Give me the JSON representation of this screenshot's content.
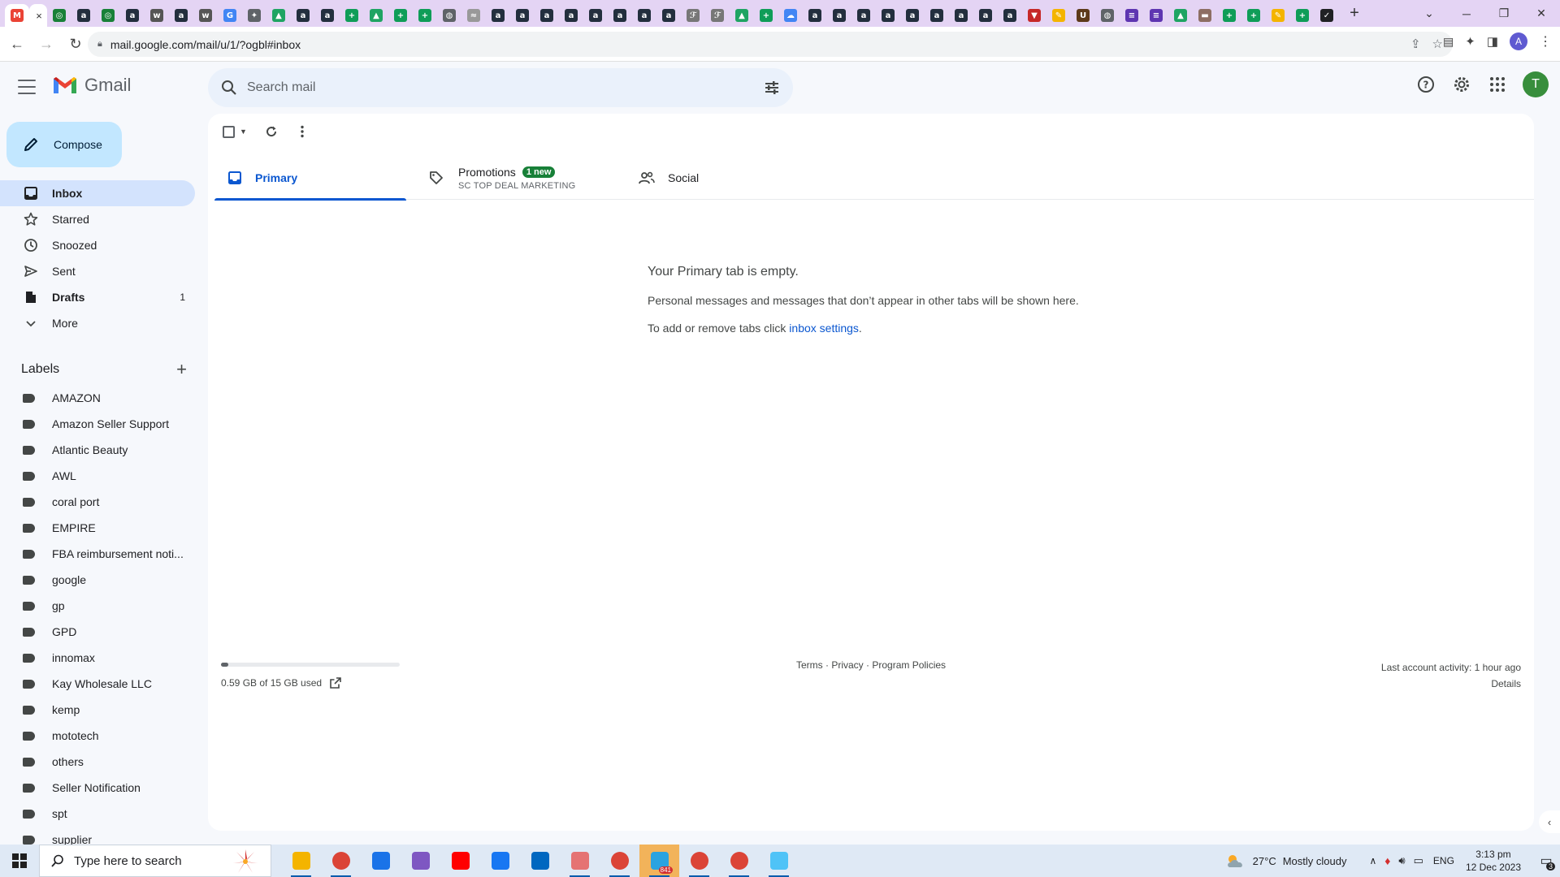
{
  "browser": {
    "url": "mail.google.com/mail/u/1/?ogbl#inbox",
    "profile_initial": "A",
    "tabs": [
      {
        "icon": "gmail-favicon",
        "color": "#ea4335",
        "glyph": "M"
      },
      {
        "icon": "active-tab-close",
        "color": "#ffffff",
        "glyph": "×"
      },
      {
        "icon": "green-circle-favicon",
        "color": "#188038",
        "glyph": "◎"
      },
      {
        "icon": "amazon-favicon",
        "color": "#232f3e",
        "glyph": "a"
      },
      {
        "icon": "green-circle-favicon",
        "color": "#188038",
        "glyph": "◎"
      },
      {
        "icon": "amazon-favicon",
        "color": "#232f3e",
        "glyph": "a"
      },
      {
        "icon": "wix-favicon",
        "color": "#555555",
        "glyph": "w"
      },
      {
        "icon": "amazon-favicon",
        "color": "#232f3e",
        "glyph": "a"
      },
      {
        "icon": "wix-favicon",
        "color": "#555555",
        "glyph": "w"
      },
      {
        "icon": "google-favicon",
        "color": "#4285f4",
        "glyph": "G"
      },
      {
        "icon": "puzzle-favicon",
        "color": "#5f6368",
        "glyph": "✦"
      },
      {
        "icon": "drive-favicon",
        "color": "#1fa463",
        "glyph": "▲"
      },
      {
        "icon": "amazon-favicon",
        "color": "#232f3e",
        "glyph": "a"
      },
      {
        "icon": "amazon-favicon",
        "color": "#232f3e",
        "glyph": "a"
      },
      {
        "icon": "sheets-favicon",
        "color": "#0f9d58",
        "glyph": "+"
      },
      {
        "icon": "drive-favicon",
        "color": "#1fa463",
        "glyph": "▲"
      },
      {
        "icon": "sheets-favicon",
        "color": "#0f9d58",
        "glyph": "+"
      },
      {
        "icon": "sheets-favicon",
        "color": "#0f9d58",
        "glyph": "+"
      },
      {
        "icon": "globe-favicon",
        "color": "#5f6368",
        "glyph": "◍"
      },
      {
        "icon": "tool-favicon",
        "color": "#999999",
        "glyph": "≈"
      },
      {
        "icon": "amazon-favicon",
        "color": "#232f3e",
        "glyph": "a"
      },
      {
        "icon": "amazon-favicon",
        "color": "#232f3e",
        "glyph": "a"
      },
      {
        "icon": "amazon-favicon",
        "color": "#232f3e",
        "glyph": "a"
      },
      {
        "icon": "amazon-favicon",
        "color": "#232f3e",
        "glyph": "a"
      },
      {
        "icon": "amazon-favicon",
        "color": "#232f3e",
        "glyph": "a"
      },
      {
        "icon": "amazon-favicon",
        "color": "#232f3e",
        "glyph": "a"
      },
      {
        "icon": "amazon-favicon",
        "color": "#232f3e",
        "glyph": "a"
      },
      {
        "icon": "amazon-favicon",
        "color": "#232f3e",
        "glyph": "a"
      },
      {
        "icon": "script-favicon",
        "color": "#777777",
        "glyph": "ℱ"
      },
      {
        "icon": "script-favicon",
        "color": "#777777",
        "glyph": "ℱ"
      },
      {
        "icon": "drive-favicon",
        "color": "#1fa463",
        "glyph": "▲"
      },
      {
        "icon": "sheets-favicon",
        "color": "#0f9d58",
        "glyph": "+"
      },
      {
        "icon": "cloud-favicon",
        "color": "#4285f4",
        "glyph": "☁"
      },
      {
        "icon": "amazon-favicon",
        "color": "#232f3e",
        "glyph": "a"
      },
      {
        "icon": "amazon-favicon",
        "color": "#232f3e",
        "glyph": "a"
      },
      {
        "icon": "amazon-favicon",
        "color": "#232f3e",
        "glyph": "a"
      },
      {
        "icon": "amazon-favicon",
        "color": "#232f3e",
        "glyph": "a"
      },
      {
        "icon": "amazon-favicon",
        "color": "#232f3e",
        "glyph": "a"
      },
      {
        "icon": "amazon-favicon",
        "color": "#232f3e",
        "glyph": "a"
      },
      {
        "icon": "amazon-favicon",
        "color": "#232f3e",
        "glyph": "a"
      },
      {
        "icon": "amazon-favicon",
        "color": "#232f3e",
        "glyph": "a"
      },
      {
        "icon": "amazon-favicon",
        "color": "#232f3e",
        "glyph": "a"
      },
      {
        "icon": "red-v-favicon",
        "color": "#c62828",
        "glyph": "▼"
      },
      {
        "icon": "pencil-favicon",
        "color": "#f4b400",
        "glyph": "✎"
      },
      {
        "icon": "ups-favicon",
        "color": "#5d3a1a",
        "glyph": "U"
      },
      {
        "icon": "globe-favicon",
        "color": "#5f6368",
        "glyph": "◍"
      },
      {
        "icon": "forms-favicon",
        "color": "#5e35b1",
        "glyph": "≡"
      },
      {
        "icon": "forms-favicon",
        "color": "#5e35b1",
        "glyph": "≡"
      },
      {
        "icon": "drive-favicon",
        "color": "#1fa463",
        "glyph": "▲"
      },
      {
        "icon": "box-favicon",
        "color": "#8d6e63",
        "glyph": "▬"
      },
      {
        "icon": "sheets-favicon",
        "color": "#0f9d58",
        "glyph": "+"
      },
      {
        "icon": "sheets-favicon",
        "color": "#0f9d58",
        "glyph": "+"
      },
      {
        "icon": "pencil-favicon",
        "color": "#f4b400",
        "glyph": "✎"
      },
      {
        "icon": "sheets-favicon",
        "color": "#0f9d58",
        "glyph": "+"
      },
      {
        "icon": "check-favicon",
        "color": "#202124",
        "glyph": "✓"
      }
    ]
  },
  "gmail": {
    "product_name": "Gmail",
    "search_placeholder": "Search mail",
    "compose_label": "Compose",
    "avatar_initial": "T",
    "nav": [
      {
        "icon": "inbox-icon",
        "label": "Inbox",
        "count": "",
        "active": true,
        "bold": true
      },
      {
        "icon": "star-icon",
        "label": "Starred",
        "count": "",
        "active": false,
        "bold": false
      },
      {
        "icon": "clock-icon",
        "label": "Snoozed",
        "count": "",
        "active": false,
        "bold": false
      },
      {
        "icon": "send-icon",
        "label": "Sent",
        "count": "",
        "active": false,
        "bold": false
      },
      {
        "icon": "draft-icon",
        "label": "Drafts",
        "count": "1",
        "active": false,
        "bold": true
      },
      {
        "icon": "chevron-down-icon",
        "label": "More",
        "count": "",
        "active": false,
        "bold": false
      }
    ],
    "labels_heading": "Labels",
    "labels": [
      "AMAZON",
      "Amazon Seller Support",
      "Atlantic Beauty",
      "AWL",
      "coral port",
      "EMPIRE",
      "FBA reimbursement noti...",
      "google",
      "gp",
      "GPD",
      "innomax",
      "Kay Wholesale LLC",
      "kemp",
      "mototech",
      "others",
      "Seller Notification",
      "spt",
      "supplier"
    ],
    "tabs": {
      "primary": "Primary",
      "promotions": "Promotions",
      "promotions_badge": "1 new",
      "promotions_sender": "SC TOP DEAL MARKETING",
      "social": "Social"
    },
    "empty_state": {
      "heading": "Your Primary tab is empty.",
      "line1": "Personal messages and messages that don’t appear in other tabs will be shown here.",
      "line2_prefix": "To add or remove tabs click ",
      "line2_link": "inbox settings",
      "line2_suffix": "."
    },
    "storage": {
      "text": "0.59 GB of 15 GB used",
      "used_fraction": 0.04
    },
    "footer": {
      "terms": "Terms",
      "privacy": "Privacy",
      "policies": "Program Policies",
      "sep": " · "
    },
    "activity": {
      "line": "Last account activity: 1 hour ago",
      "details": "Details"
    }
  },
  "taskbar": {
    "search_placeholder": "Type here to search",
    "weather_temp": "27°C",
    "weather_desc": "Mostly cloudy",
    "lang": "ENG",
    "time": "3:13 pm",
    "date": "12 Dec 2023",
    "notification_count": "3",
    "apps": [
      {
        "icon": "file-explorer-icon",
        "color": "#f4b400"
      },
      {
        "icon": "chrome-profile-icon",
        "color": "#db4437"
      },
      {
        "icon": "calculator-icon",
        "color": "#1a73e8"
      },
      {
        "icon": "copilot-icon",
        "color": "#7e57c2"
      },
      {
        "icon": "youtube-icon",
        "color": "#ff0000"
      },
      {
        "icon": "facebook-icon",
        "color": "#1877f2"
      },
      {
        "icon": "store-icon",
        "color": "#0067c0"
      },
      {
        "icon": "snipping-icon",
        "color": "#e57373"
      },
      {
        "icon": "chrome-icon",
        "color": "#db4437"
      },
      {
        "icon": "telegram-icon",
        "color": "#2aa3e0"
      },
      {
        "icon": "chrome-icon",
        "color": "#db4437"
      },
      {
        "icon": "chrome-icon",
        "color": "#db4437"
      },
      {
        "icon": "notepad-icon",
        "color": "#4fc3f7"
      }
    ],
    "telegram_badge": "841"
  }
}
